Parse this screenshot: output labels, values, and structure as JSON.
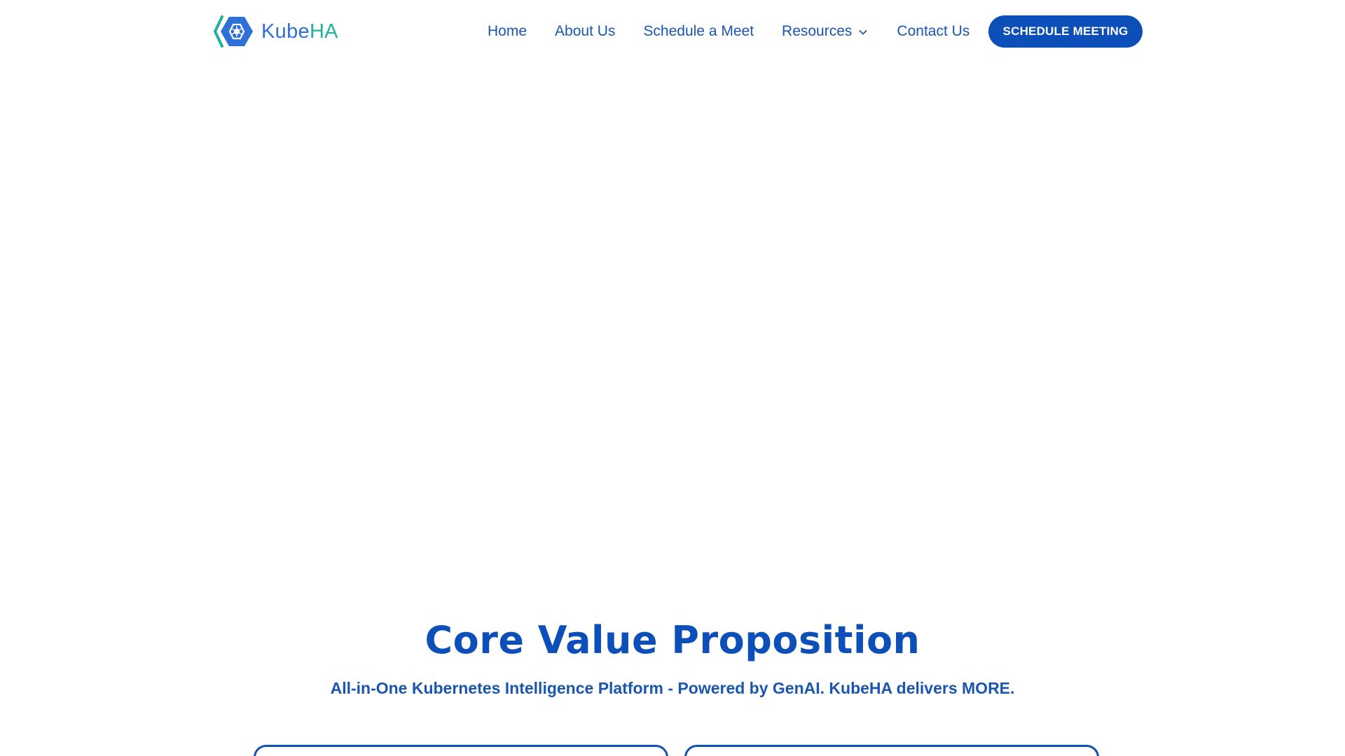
{
  "brand": {
    "name_part1": "Kube",
    "name_part2": "HA",
    "primary_color": "#0d4fb8",
    "accent_color": "#23b0a0"
  },
  "nav": {
    "items": [
      {
        "label": "Home"
      },
      {
        "label": "About Us"
      },
      {
        "label": "Schedule a Meet"
      },
      {
        "label": "Resources",
        "has_dropdown": true
      },
      {
        "label": "Contact Us"
      }
    ],
    "cta_label": "SCHEDULE MEETING"
  },
  "core_value": {
    "title": "Core Value Proposition",
    "subtitle": "All-in-One Kubernetes Intelligence Platform - Powered by GenAI. KubeHA delivers MORE."
  }
}
